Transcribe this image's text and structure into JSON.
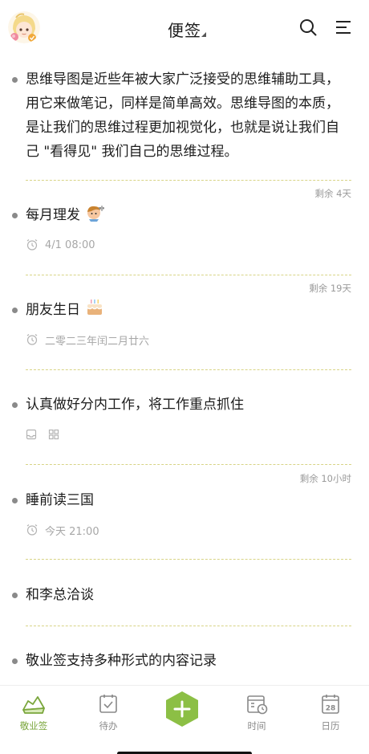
{
  "header": {
    "title": "便签",
    "avatar_icon": "anime-avatar-icon",
    "search_icon": "search-icon",
    "menu_icon": "menu-icon"
  },
  "notes": [
    {
      "text": "思维导图是近些年被大家广泛接受的思维辅助工具，用它来做笔记，同样是简单高效。思维导图的本质，是让我们的思维过程更加视觉化，也就是说让我们自己 \"看得见\" 我们自己的思维过程。"
    },
    {
      "remaining": "剩余 4天",
      "text": "每月理发",
      "emoji": "barber-emoji",
      "reminder": "4/1 08:00",
      "reminder_icon": "repeat-alarm-icon"
    },
    {
      "remaining": "剩余 19天",
      "text": "朋友生日",
      "emoji": "birthday-cake-emoji",
      "reminder": "二零二三年闰二月廿六",
      "reminder_icon": "repeat-alarm-icon"
    },
    {
      "text": "认真做好分内工作，将工作重点抓住",
      "meta_icons": [
        "inbox-icon",
        "grid-icon"
      ]
    },
    {
      "remaining": "剩余 10小时",
      "text": "睡前读三国",
      "reminder": "今天 21:00",
      "reminder_icon": "repeat-alarm-icon"
    },
    {
      "text": "和李总洽谈"
    },
    {
      "text": "敬业签支持多种形式的内容记录"
    }
  ],
  "tabbar": {
    "tabs": [
      {
        "label": "敬业签",
        "icon": "note-home-icon",
        "active": true
      },
      {
        "label": "待办",
        "icon": "todo-check-icon",
        "active": false
      },
      {
        "label": "",
        "icon": "add-hexagon-icon",
        "active": false
      },
      {
        "label": "时间",
        "icon": "time-calendar-icon",
        "active": false
      },
      {
        "label": "日历",
        "icon": "calendar-28-icon",
        "active": false
      }
    ],
    "calendar_day": "28"
  },
  "colors": {
    "accent": "#7aa63c",
    "fab": "#8cbf45",
    "divider": "#d8d486",
    "bullet": "#8a8a8a"
  }
}
